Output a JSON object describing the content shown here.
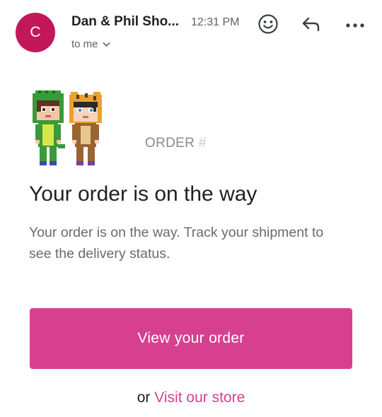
{
  "header": {
    "avatar_letter": "C",
    "sender": "Dan & Phil Sho...",
    "time": "12:31 PM",
    "recipient": "to me",
    "icons": [
      "emoji-icon",
      "reply-icon",
      "more-options-icon",
      "chevron-down-icon"
    ]
  },
  "email": {
    "order_label": "ORDER",
    "order_hash": "#",
    "heading": "Your order is on the way",
    "body": "Your order is on the way. Track your shipment to see the delivery status.",
    "cta_label": "View your order",
    "store_prefix": "or",
    "store_link": "Visit our store"
  },
  "colors": {
    "avatar": "#c2185b",
    "accent": "#d6408f"
  }
}
